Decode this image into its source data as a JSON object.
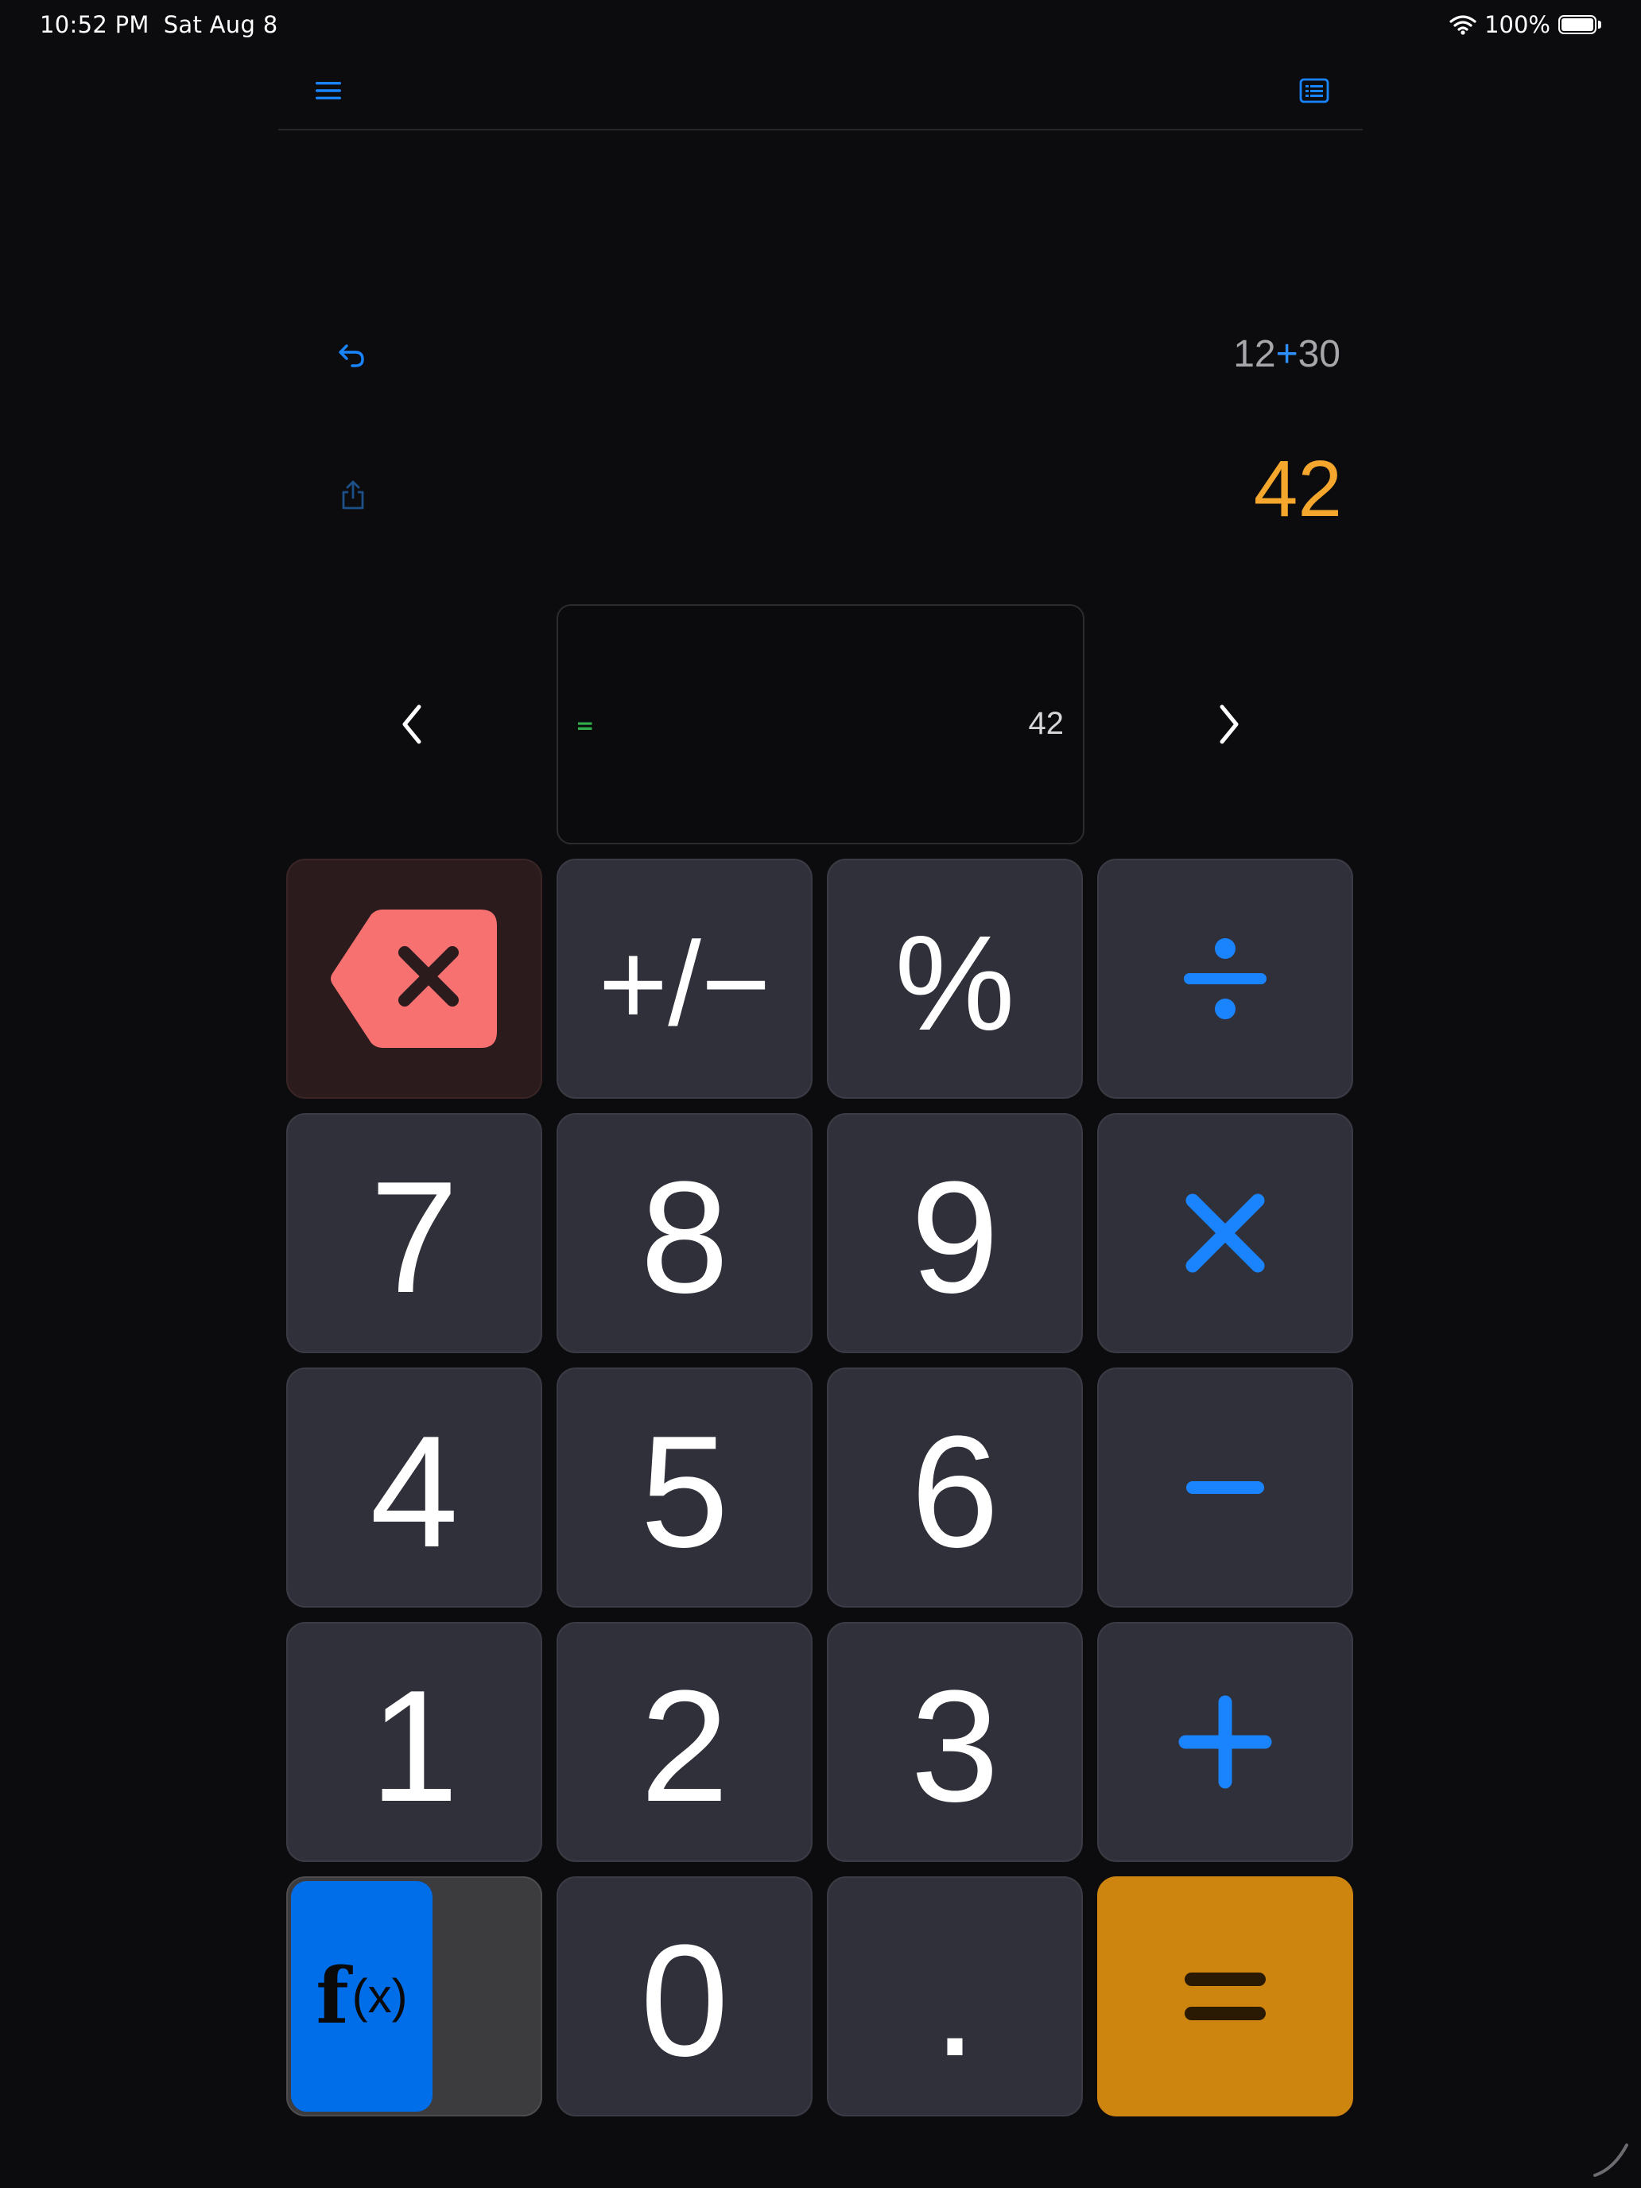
{
  "status_bar": {
    "time": "10:52 PM",
    "date": "Sat Aug 8",
    "battery": "100%",
    "wifi_icon": "wifi-icon",
    "battery_icon": "battery-icon"
  },
  "toolbar": {
    "menu_icon": "hamburger-menu-icon",
    "history_icon": "history-list-icon"
  },
  "display": {
    "expression_left": "12",
    "expression_op": "+",
    "expression_right": "30",
    "result": "42",
    "undo_icon": "undo-icon",
    "share_icon": "share-icon"
  },
  "history_card": {
    "eq_symbol": "=",
    "value": "42",
    "prev_icon": "chevron-left-icon",
    "next_icon": "chevron-right-icon"
  },
  "keypad": {
    "backspace_icon": "backspace-icon",
    "plusminus": "+/−",
    "percent": "%",
    "divide_icon": "divide-icon",
    "multiply_icon": "multiply-icon",
    "minus_icon": "minus-icon",
    "plus_icon": "plus-icon",
    "equals_icon": "equals-icon",
    "digits": {
      "seven": "7",
      "eight": "8",
      "nine": "9",
      "four": "4",
      "five": "5",
      "six": "6",
      "one": "1",
      "two": "2",
      "three": "3",
      "zero": "0",
      "decimal": "."
    },
    "fx_f": "f",
    "fx_x": "(x)"
  },
  "colors": {
    "background": "#0c0c0e",
    "key": "#2f3039",
    "accent_blue": "#1a84ff",
    "result_orange": "#f4a72c",
    "equals_key": "#cd8510",
    "backspace_red": "#f87171",
    "fx_blue": "#006ee8",
    "history_green": "#2fae4b"
  }
}
